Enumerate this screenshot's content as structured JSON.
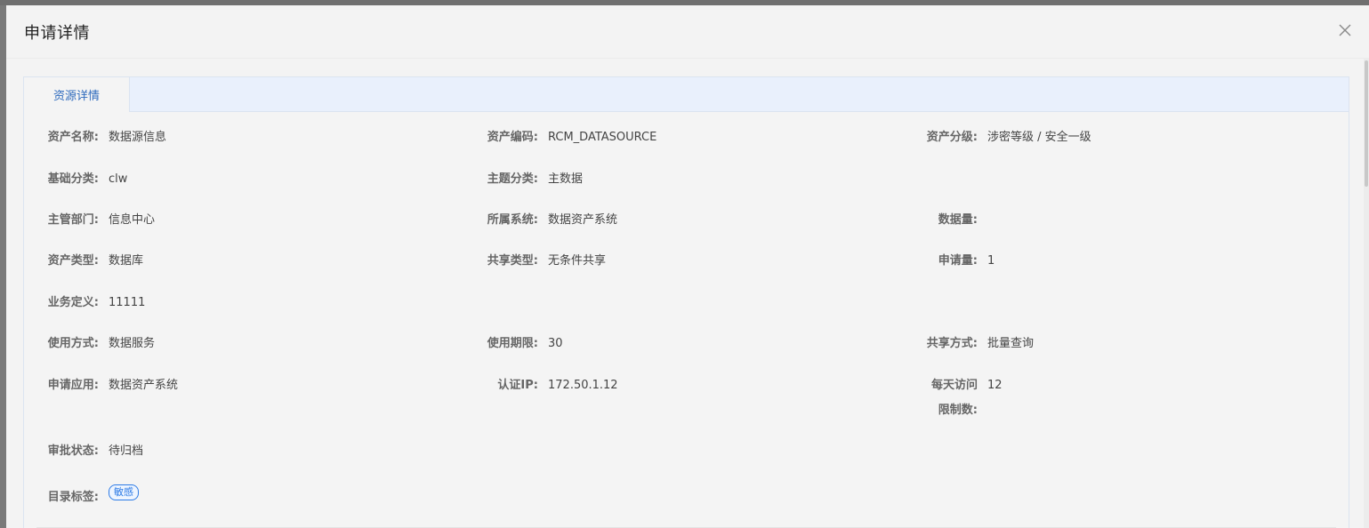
{
  "dialog": {
    "title": "申请详情",
    "close_icon": "close-icon"
  },
  "tabs": [
    {
      "label": "资源详情",
      "active": true
    }
  ],
  "colors": {
    "accent": "#2f6bbd",
    "tab_bar_bg": "#e9f0fc",
    "tag_border": "#2d7be6"
  },
  "details": {
    "asset_name": {
      "label": "资产名称:",
      "value": "数据源信息"
    },
    "asset_code": {
      "label": "资产编码:",
      "value": "RCM_DATASOURCE"
    },
    "asset_level": {
      "label": "资产分级:",
      "value": "涉密等级 / 安全一级"
    },
    "base_category": {
      "label": "基础分类:",
      "value": "clw"
    },
    "topic_category": {
      "label": "主题分类:",
      "value": "主数据"
    },
    "department": {
      "label": "主管部门:",
      "value": "信息中心"
    },
    "system": {
      "label": "所属系统:",
      "value": "数据资产系统"
    },
    "data_volume": {
      "label": "数据量:",
      "value": ""
    },
    "asset_type": {
      "label": "资产类型:",
      "value": "数据库"
    },
    "share_type": {
      "label": "共享类型:",
      "value": "无条件共享"
    },
    "apply_count": {
      "label": "申请量:",
      "value": "1"
    },
    "business_def": {
      "label": "业务定义:",
      "value": "11111"
    },
    "usage_mode": {
      "label": "使用方式:",
      "value": "数据服务"
    },
    "usage_period": {
      "label": "使用期限:",
      "value": "30"
    },
    "share_mode": {
      "label": "共享方式:",
      "value": "批量查询"
    },
    "apply_app": {
      "label": "申请应用:",
      "value": "数据资产系统"
    },
    "auth_ip": {
      "label": "认证IP:",
      "value": "172.50.1.12"
    },
    "daily_limit": {
      "label_line1": "每天访问",
      "label_line2": "限制数:",
      "value": "12"
    },
    "approval_status": {
      "label": "审批状态:",
      "value": "待归档"
    },
    "catalog_tag": {
      "label": "目录标签:",
      "tags": [
        "敏感"
      ]
    }
  }
}
